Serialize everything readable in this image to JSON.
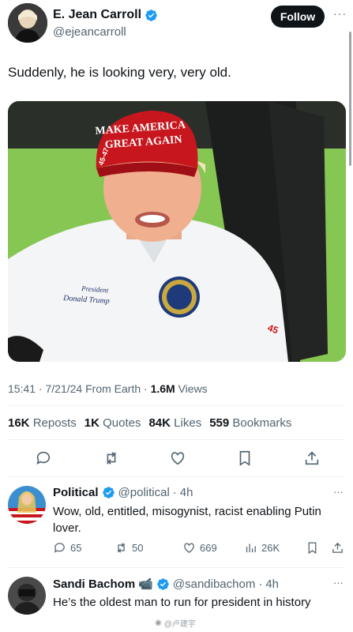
{
  "post": {
    "author_name": "E. Jean Carroll",
    "author_handle": "@ejeancarroll",
    "follow_label": "Follow",
    "more_label": "···",
    "text": "Suddenly, he is looking very, very old.",
    "photo": {
      "hat_line1": "MAKE AMERICA",
      "hat_line2": "GREAT AGAIN",
      "hat_side": "45-47",
      "shirt_text_line1": "President",
      "shirt_text_line2": "Donald Trump",
      "sleeve_number": "45"
    },
    "time": "15:41",
    "date": "7/21/24",
    "source": "From Earth",
    "views_count": "1.6M",
    "views_label": "Views",
    "stats": [
      {
        "count": "16K",
        "label": "Reposts"
      },
      {
        "count": "1K",
        "label": "Quotes"
      },
      {
        "count": "84K",
        "label": "Likes"
      },
      {
        "count": "559",
        "label": "Bookmarks"
      }
    ]
  },
  "replies": [
    {
      "name": "Political",
      "handle": "@political",
      "time": "4h",
      "text": "Wow, old, entitled, misogynist, racist enabling Putin lover.",
      "replies": "65",
      "reposts": "50",
      "likes": "669",
      "views": "26K"
    },
    {
      "name": "Sandi Bachom",
      "handle": "@sandibachom",
      "time": "4h",
      "text": "He’s the oldest man to run for president in history"
    }
  ],
  "watermark": "@卢建宇",
  "colors": {
    "verified_blue": "#1d9bf0",
    "text_primary": "#0f1419",
    "text_secondary": "#536471",
    "follow_button": "#0f1419"
  }
}
